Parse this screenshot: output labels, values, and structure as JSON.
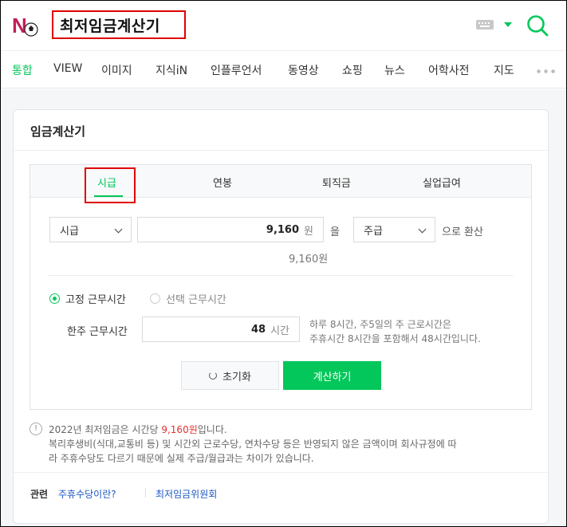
{
  "header": {
    "query": "최저임금계산기"
  },
  "nav": {
    "items": [
      "통합",
      "VIEW",
      "이미지",
      "지식iN",
      "인플루언서",
      "동영상",
      "쇼핑",
      "뉴스",
      "어학사전",
      "지도"
    ]
  },
  "card": {
    "title": "임금계산기",
    "tabs": [
      "시급",
      "연봉",
      "퇴직금",
      "실업급여"
    ],
    "active_tab": "시급",
    "from_unit": "시급",
    "amount": "9,160",
    "amount_unit": "원",
    "particle": "을",
    "to_unit": "주급",
    "convert_suffix": "으로 환산",
    "amount_readout": "9,160원",
    "radio_fixed": "고정 근무시간",
    "radio_select": "선택 근무시간",
    "weekly_label": "한주 근무시간",
    "weekly_hours": "48",
    "hours_unit": "시간",
    "hint_line1": "하루 8시간, 주5일의 주 근로시간은",
    "hint_line2": "주휴시간 8시간을 포함해서 48시간입니다.",
    "reset_label": "초기화",
    "calc_label": "계산하기"
  },
  "notice": {
    "line1_pre": "2022년 최저임금은 시간당 ",
    "line1_red": "9,160원",
    "line1_post": "입니다.",
    "line2": "복리후생비(식대,교통비 등) 및 시간외 근로수당, 연차수당 등은 반영되지 않은 금액이며 회사규정에 따",
    "line3": "라 주휴수당도 다르기 때문에 실제 주급/월급과는 차이가 있습니다."
  },
  "related": {
    "label": "관련",
    "link1": "주휴수당이란?",
    "link2": "최저임금위원회"
  },
  "colors": {
    "brand_green": "#03c75a",
    "highlight_red": "#e00000",
    "wage_red": "#e3302f",
    "link_blue": "#1a57c4"
  }
}
